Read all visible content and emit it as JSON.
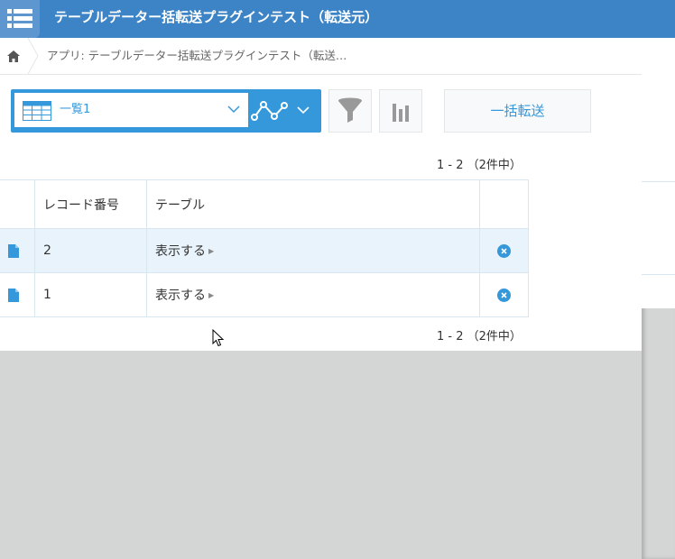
{
  "header": {
    "menu_icon": "list-menu-icon",
    "title": "テーブルデーター括転送プラグインテスト（転送元）",
    "color": "#3d84c6"
  },
  "breadcrumb": {
    "home_icon": "home-icon",
    "text": "アプリ: テーブルデーター括転送プラグインテスト（転送…"
  },
  "toolbar": {
    "view_icon": "table-view-icon",
    "view_label": "一覧1",
    "graph_icon": "line-graph-icon",
    "filter_icon": "filter-icon",
    "chart_icon": "bar-chart-icon",
    "bulk_button": "一括転送",
    "accent": "#3498db"
  },
  "pagination": {
    "top": "1 - 2 （2件中）",
    "bottom": "1 - 2 （2件中）"
  },
  "table": {
    "columns": [
      "",
      "レコード番号",
      "テーブル",
      ""
    ],
    "rows": [
      {
        "record_no": "2",
        "table_link": "表示する"
      },
      {
        "record_no": "1",
        "table_link": "表示する"
      }
    ]
  }
}
